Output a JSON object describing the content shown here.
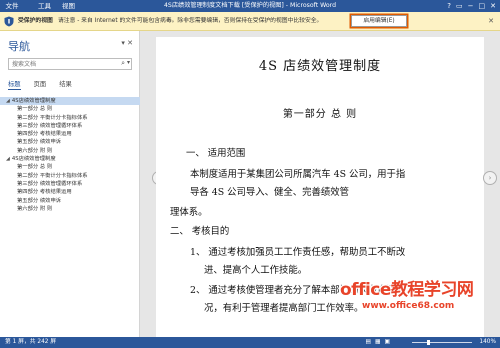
{
  "menubar": {
    "file": "文件",
    "tools": "工具",
    "view": "视图",
    "window_title": "4S店绩效管理制度文档下载 [受保护的视图] - Microsoft Word",
    "btn_help": "?",
    "btn_restore": "▭",
    "btn_min": "−",
    "btn_max": "□",
    "btn_close": "✕"
  },
  "protected_bar": {
    "title": "受保护的视图",
    "message": "请注意 - 来自 Internet 的文件可能包含病毒。除非您需要编辑，否则保持在受保护的视图中比较安全。",
    "enable_label": "启用编辑(E)",
    "close_label": "✕"
  },
  "nav": {
    "title": "导航",
    "search_placeholder": "搜索文档",
    "tabs": [
      "标题",
      "页面",
      "结果"
    ],
    "items": [
      {
        "label": "4S店绩效管理制度",
        "level": 1,
        "selected": true
      },
      {
        "label": "第一部分 总 则",
        "level": 2
      },
      {
        "label": "第二部分 平衡计分卡指标体系",
        "level": 2
      },
      {
        "label": "第三部分 绩效管理循环体系",
        "level": 2
      },
      {
        "label": "第四部分 考核结果运用",
        "level": 2
      },
      {
        "label": "第五部分 绩效申诉",
        "level": 2
      },
      {
        "label": "第六部分 附 则",
        "level": 2
      },
      {
        "label": "4S店绩效管理制度",
        "level": 1
      },
      {
        "label": "第一部分 总 则",
        "level": 2
      },
      {
        "label": "第二部分 平衡计分卡指标体系",
        "level": 2
      },
      {
        "label": "第三部分 绩效管理循环体系",
        "level": 2
      },
      {
        "label": "第四部分 考核结果运用",
        "level": 2
      },
      {
        "label": "第五部分 绩效申诉",
        "level": 2
      },
      {
        "label": "第六部分 附 则",
        "level": 2
      }
    ]
  },
  "document": {
    "title": "4S 店绩效管理制度",
    "part_heading": "第一部分 总 则",
    "lines": [
      "一、    适用范围",
      "本制度适用于某集团公司所属汽车 4S 公司，用于指",
      "导各 4S 公司导入、健全、完善绩效管",
      "理体系。",
      "二、    考核目的",
      "1、  通过考核加强员工工作责任感，帮助员工不断改",
      "进、提高个人工作技能。",
      "2、  通过考核使管理者充分了解本部门的人力资源状",
      "况，有利于管理者提高部门工作效率。"
    ]
  },
  "statusbar": {
    "page_info": "第 1 屏，共 242 屏",
    "zoom": "140%",
    "zoom_level_percent": 140
  },
  "watermark": {
    "brand_latin": "office",
    "brand_cn": "教程学习网",
    "url": "www.office68.com"
  }
}
